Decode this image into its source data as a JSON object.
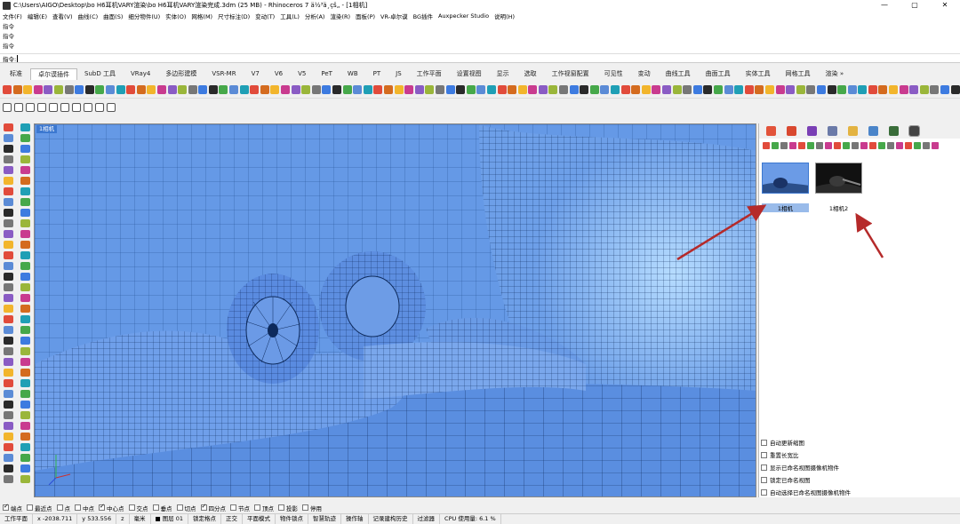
{
  "window": {
    "title": "C:\\Users\\AIGO\\Desktop\\bo H6耳机VARY渲染\\bo H6耳机VARY渲染完成.3dm (25 MB) - Rhinoceros 7 ä½³ä¸çš„ - [1相机]",
    "minimize": "—",
    "maximize": "▢",
    "close": "✕"
  },
  "menu": [
    "文件(F)",
    "编辑(E)",
    "查看(V)",
    "曲线(C)",
    "曲面(S)",
    "细分物件(U)",
    "实体(O)",
    "网格(M)",
    "尺寸标注(D)",
    "变动(T)",
    "工具(L)",
    "分析(A)",
    "渲染(R)",
    "面板(P)",
    "VR-卓尔谟",
    "BG插件",
    "Auxpecker Studio",
    "说明(H)"
  ],
  "command_history": [
    "指令",
    "指令",
    "指令"
  ],
  "command_prompt": "指令:",
  "tabs": [
    {
      "label": "标准",
      "active": false
    },
    {
      "label": "卓尔谟插件",
      "active": true
    },
    {
      "label": "SubD 工具",
      "active": false
    },
    {
      "label": "VRay4",
      "active": false
    },
    {
      "label": "多边形建模",
      "active": false
    },
    {
      "label": "VSR-MR",
      "active": false
    },
    {
      "label": "V7",
      "active": false
    },
    {
      "label": "V6",
      "active": false
    },
    {
      "label": "V5",
      "active": false
    },
    {
      "label": "PeT",
      "active": false
    },
    {
      "label": "WB",
      "active": false
    },
    {
      "label": "PT",
      "active": false
    },
    {
      "label": "JS",
      "active": false
    },
    {
      "label": "工作平面",
      "active": false
    },
    {
      "label": "设置视图",
      "active": false
    },
    {
      "label": "显示",
      "active": false
    },
    {
      "label": "选取",
      "active": false
    },
    {
      "label": "工作视窗配置",
      "active": false
    },
    {
      "label": "可见性",
      "active": false
    },
    {
      "label": "变动",
      "active": false
    },
    {
      "label": "曲线工具",
      "active": false
    },
    {
      "label": "曲面工具",
      "active": false
    },
    {
      "label": "实体工具",
      "active": false
    },
    {
      "label": "网格工具",
      "active": false
    },
    {
      "label": "渲染 »",
      "active": false
    }
  ],
  "viewport": {
    "label": "1相机",
    "bg": "#5f94e6"
  },
  "panel": {
    "thumbs": [
      {
        "label": "1相机",
        "selected": true
      },
      {
        "label": "1相机2",
        "selected": false
      }
    ],
    "options": [
      "自动更新缩图",
      "重置长宽比",
      "显示已命名视图摄像机物件",
      "锁定已命名视图",
      "自动选择已命名视图摄像机物件"
    ]
  },
  "osnap": [
    {
      "label": "端点",
      "on": true
    },
    {
      "label": "最近点",
      "on": false
    },
    {
      "label": "点",
      "on": false
    },
    {
      "label": "中点",
      "on": false
    },
    {
      "label": "中心点",
      "on": true
    },
    {
      "label": "交点",
      "on": false
    },
    {
      "label": "垂点",
      "on": false
    },
    {
      "label": "切点",
      "on": false
    },
    {
      "label": "四分点",
      "on": true
    },
    {
      "label": "节点",
      "on": false
    },
    {
      "label": "顶点",
      "on": false
    },
    {
      "label": "投影",
      "on": false
    },
    {
      "label": "停用",
      "on": false
    }
  ],
  "status": [
    "工作平面",
    "x -2038.711",
    "y 533.556",
    "z",
    "毫米",
    "■ 图层 01",
    "锁定格点",
    "正交",
    "平面模式",
    "物件锁点",
    "智慧轨迹",
    "操作轴",
    "记录建构历史",
    "过滤器",
    "CPU 使用量: 6.1 %"
  ],
  "colors": {
    "accent": "#3c78d0",
    "arrow": "#b52a2a",
    "mesh": "#0d2a5c"
  }
}
